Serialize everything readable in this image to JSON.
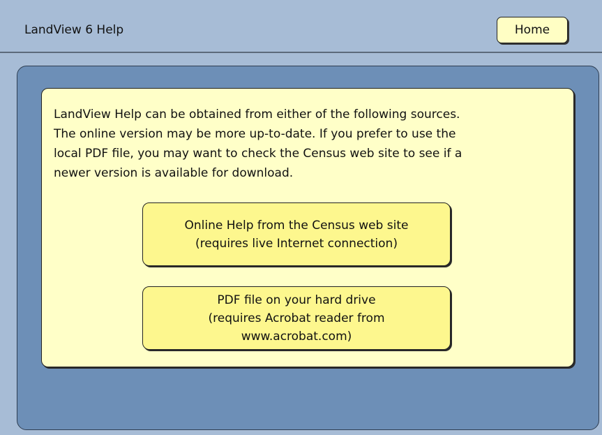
{
  "window": {
    "title": "LandView 6 Help"
  },
  "toolbar": {
    "home_label": "Home"
  },
  "content": {
    "intro_text": "LandView Help can be obtained from either of the following sources.\nThe online version may be more up-to-date.  If you prefer to use the\nlocal PDF file, you may want to check the Census web site to see if a\nnewer version is available for download.",
    "online_help_label": "Online Help from the Census web site\n(requires live Internet connection)",
    "pdf_help_label": "PDF file on your hard drive\n(requires Acrobat reader from\nwww.acrobat.com)"
  },
  "colors": {
    "background": "#a7bcd6",
    "panel": "#6d8fb7",
    "card": "#ffffc8",
    "button": "#fdf78e"
  }
}
